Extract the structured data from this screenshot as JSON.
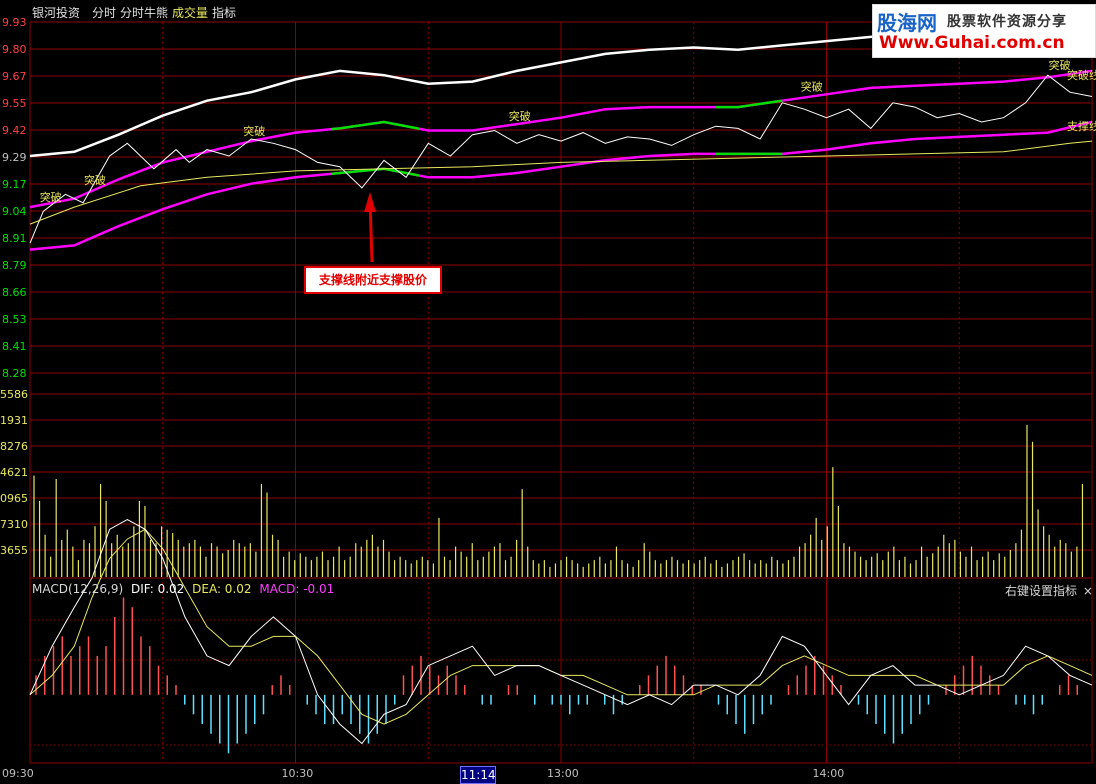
{
  "menu": {
    "app": "银河投资",
    "item1": "分时",
    "item2": "分时牛熊",
    "item3": "成交量",
    "item4": "指标"
  },
  "logo": {
    "line1": "股海网",
    "line2": "股票软件资源分享",
    "line3": "Www.Guhai.com.cn"
  },
  "callout": {
    "text": "支撑线附近支撑股价"
  },
  "macd_label": {
    "name": "MACD(12,26,9)",
    "dif": "DIF: 0.02",
    "dea": "DEA: 0.02",
    "macd": "MACD: -0.01"
  },
  "right_setting": "右键设置指标",
  "right_close": "×",
  "time_current": "11:14",
  "colors": {
    "grid": "#8b0000",
    "price": "#ffffff",
    "avg": "#e8e860",
    "magenta": "#ff00ff",
    "green": "#00e000",
    "volume": "#e8e860",
    "macd_pos": "#ff5050",
    "macd_neg": "#60e0ff",
    "label_up": "#ff4040",
    "label_down": "#00e000"
  },
  "chart_data": {
    "type": "line",
    "price_axis_ticks": [
      "9.93",
      "9.80",
      "9.67",
      "9.55",
      "9.42",
      "9.29",
      "9.17",
      "9.04",
      "8.91",
      "8.79",
      "8.66",
      "8.53",
      "8.41",
      "8.28"
    ],
    "volume_axis_ticks": [
      "5586",
      "1931",
      "8276",
      "4621",
      "0965",
      "7310",
      "3655"
    ],
    "x_ticks": [
      "09:30",
      "10:30",
      "13:00",
      "14:00"
    ],
    "ylim": [
      8.28,
      9.93
    ],
    "price": {
      "t": [
        0,
        3,
        8,
        12,
        18,
        22,
        28,
        33,
        36,
        40,
        45,
        50,
        55,
        60,
        65,
        70,
        75,
        80,
        85,
        90,
        95,
        100,
        105,
        110,
        115,
        120,
        125,
        130,
        135,
        140,
        145,
        150,
        155,
        160,
        165,
        170,
        175,
        180,
        185,
        190,
        195,
        200,
        205,
        210,
        215,
        220,
        225,
        230,
        235,
        240
      ],
      "v": [
        8.89,
        9.04,
        9.12,
        9.08,
        9.3,
        9.36,
        9.24,
        9.33,
        9.27,
        9.33,
        9.3,
        9.38,
        9.36,
        9.33,
        9.27,
        9.25,
        9.15,
        9.28,
        9.2,
        9.36,
        9.3,
        9.4,
        9.42,
        9.36,
        9.4,
        9.37,
        9.41,
        9.36,
        9.39,
        9.38,
        9.35,
        9.4,
        9.44,
        9.43,
        9.38,
        9.55,
        9.52,
        9.48,
        9.52,
        9.43,
        9.55,
        9.53,
        9.48,
        9.5,
        9.46,
        9.48,
        9.55,
        9.68,
        9.6,
        9.58
      ]
    },
    "avg": {
      "t": [
        0,
        10,
        25,
        40,
        60,
        80,
        100,
        120,
        140,
        160,
        180,
        200,
        220,
        235,
        240
      ],
      "v": [
        8.98,
        9.06,
        9.16,
        9.2,
        9.23,
        9.24,
        9.25,
        9.27,
        9.28,
        9.29,
        9.3,
        9.31,
        9.32,
        9.36,
        9.37
      ]
    },
    "upper": {
      "t": [
        0,
        10,
        20,
        30,
        40,
        50,
        60,
        70,
        80,
        90,
        100,
        110,
        120,
        130,
        140,
        150,
        160,
        170,
        180,
        190,
        200,
        210,
        220,
        230,
        240
      ],
      "v": [
        9.3,
        9.32,
        9.4,
        9.49,
        9.56,
        9.6,
        9.66,
        9.7,
        9.68,
        9.64,
        9.65,
        9.7,
        9.74,
        9.78,
        9.8,
        9.81,
        9.8,
        9.82,
        9.84,
        9.86,
        9.88,
        9.89,
        9.89,
        9.9,
        9.91
      ]
    },
    "resistance": {
      "t": [
        0,
        10,
        20,
        30,
        40,
        50,
        60,
        70,
        80,
        85,
        90,
        100,
        110,
        120,
        130,
        140,
        150,
        160,
        170,
        180,
        190,
        200,
        210,
        220,
        230,
        240
      ],
      "v": [
        9.06,
        9.1,
        9.19,
        9.27,
        9.32,
        9.37,
        9.41,
        9.43,
        9.46,
        9.44,
        9.42,
        9.42,
        9.45,
        9.48,
        9.52,
        9.53,
        9.53,
        9.53,
        9.56,
        9.59,
        9.62,
        9.63,
        9.64,
        9.65,
        9.67,
        9.7
      ],
      "green_ranges": [
        [
          68,
          88
        ],
        [
          155,
          170
        ]
      ]
    },
    "support": {
      "t": [
        0,
        10,
        20,
        30,
        40,
        50,
        60,
        70,
        80,
        85,
        90,
        100,
        110,
        120,
        130,
        140,
        150,
        160,
        170,
        180,
        190,
        200,
        210,
        220,
        230,
        240
      ],
      "v": [
        8.86,
        8.88,
        8.97,
        9.05,
        9.12,
        9.17,
        9.2,
        9.22,
        9.24,
        9.22,
        9.2,
        9.2,
        9.22,
        9.25,
        9.28,
        9.3,
        9.31,
        9.31,
        9.31,
        9.33,
        9.36,
        9.38,
        9.39,
        9.4,
        9.41,
        9.46
      ],
      "green_ranges": [
        [
          68,
          88
        ],
        [
          155,
          170
        ]
      ]
    },
    "breakout_label": "突破",
    "breakouts": [
      {
        "t": 4,
        "v": 9.06
      },
      {
        "t": 14,
        "v": 9.14
      },
      {
        "t": 50,
        "v": 9.37
      },
      {
        "t": 110,
        "v": 9.44
      },
      {
        "t": 176,
        "v": 9.58
      },
      {
        "t": 232,
        "v": 9.68
      }
    ],
    "right_labels": [
      {
        "text": "突破线",
        "v": 9.68
      },
      {
        "text": "支撑线",
        "v": 9.44
      }
    ],
    "volume": [
      0.6,
      0.45,
      0.25,
      0.12,
      0.58,
      0.22,
      0.28,
      0.18,
      0.1,
      0.22,
      0.2,
      0.3,
      0.55,
      0.45,
      0.2,
      0.25,
      0.18,
      0.2,
      0.3,
      0.45,
      0.42,
      0.22,
      0.2,
      0.3,
      0.28,
      0.26,
      0.22,
      0.18,
      0.2,
      0.22,
      0.18,
      0.12,
      0.2,
      0.18,
      0.14,
      0.16,
      0.22,
      0.2,
      0.18,
      0.2,
      0.15,
      0.55,
      0.5,
      0.25,
      0.22,
      0.12,
      0.15,
      0.1,
      0.14,
      0.12,
      0.1,
      0.12,
      0.15,
      0.1,
      0.12,
      0.18,
      0.1,
      0.12,
      0.2,
      0.18,
      0.22,
      0.25,
      0.18,
      0.22,
      0.15,
      0.1,
      0.12,
      0.1,
      0.08,
      0.1,
      0.12,
      0.1,
      0.08,
      0.35,
      0.12,
      0.1,
      0.18,
      0.15,
      0.12,
      0.2,
      0.1,
      0.12,
      0.15,
      0.18,
      0.2,
      0.1,
      0.12,
      0.22,
      0.52,
      0.18,
      0.1,
      0.08,
      0.1,
      0.06,
      0.08,
      0.1,
      0.12,
      0.1,
      0.08,
      0.06,
      0.08,
      0.1,
      0.12,
      0.08,
      0.1,
      0.18,
      0.1,
      0.08,
      0.06,
      0.1,
      0.2,
      0.15,
      0.1,
      0.08,
      0.1,
      0.12,
      0.1,
      0.08,
      0.1,
      0.08,
      0.1,
      0.12,
      0.08,
      0.1,
      0.06,
      0.08,
      0.1,
      0.12,
      0.14,
      0.1,
      0.08,
      0.1,
      0.08,
      0.12,
      0.1,
      0.08,
      0.1,
      0.12,
      0.18,
      0.2,
      0.25,
      0.35,
      0.22,
      0.3,
      0.65,
      0.42,
      0.2,
      0.18,
      0.15,
      0.12,
      0.1,
      0.12,
      0.14,
      0.1,
      0.15,
      0.18,
      0.1,
      0.12,
      0.08,
      0.1,
      0.18,
      0.12,
      0.14,
      0.18,
      0.25,
      0.2,
      0.22,
      0.15,
      0.12,
      0.18,
      0.1,
      0.12,
      0.15,
      0.1,
      0.14,
      0.12,
      0.16,
      0.2,
      0.28,
      0.9,
      0.8,
      0.4,
      0.3,
      0.25,
      0.18,
      0.22,
      0.2,
      0.15,
      0.18,
      0.55
    ],
    "macd_dif": {
      "t": [
        0,
        5,
        10,
        14,
        18,
        22,
        26,
        30,
        35,
        40,
        45,
        50,
        55,
        60,
        65,
        70,
        75,
        80,
        85,
        90,
        95,
        100,
        105,
        110,
        115,
        120,
        125,
        130,
        135,
        140,
        145,
        150,
        155,
        160,
        165,
        170,
        175,
        180,
        185,
        190,
        195,
        200,
        205,
        210,
        215,
        220,
        225,
        230,
        235,
        240
      ],
      "v": [
        0.0,
        0.05,
        0.09,
        0.12,
        0.17,
        0.18,
        0.17,
        0.14,
        0.08,
        0.04,
        0.03,
        0.06,
        0.08,
        0.06,
        0.0,
        -0.03,
        -0.05,
        -0.02,
        -0.01,
        0.03,
        0.04,
        0.05,
        0.02,
        0.03,
        0.03,
        0.02,
        0.01,
        0.0,
        -0.01,
        0.0,
        -0.01,
        0.01,
        0.01,
        0.0,
        0.02,
        0.06,
        0.05,
        0.02,
        -0.01,
        0.02,
        0.03,
        0.01,
        0.01,
        0.0,
        0.01,
        0.02,
        0.05,
        0.04,
        0.02,
        0.01
      ]
    },
    "macd_dea": {
      "t": [
        0,
        5,
        10,
        14,
        18,
        22,
        26,
        30,
        35,
        40,
        45,
        50,
        55,
        60,
        65,
        70,
        75,
        80,
        85,
        90,
        95,
        100,
        105,
        110,
        115,
        120,
        125,
        130,
        135,
        140,
        145,
        150,
        155,
        160,
        165,
        170,
        175,
        180,
        185,
        190,
        195,
        200,
        205,
        210,
        215,
        220,
        225,
        230,
        235,
        240
      ],
      "v": [
        0.0,
        0.02,
        0.05,
        0.1,
        0.14,
        0.16,
        0.17,
        0.15,
        0.11,
        0.07,
        0.05,
        0.05,
        0.06,
        0.06,
        0.04,
        0.01,
        -0.02,
        -0.03,
        -0.02,
        0.0,
        0.02,
        0.03,
        0.03,
        0.03,
        0.03,
        0.02,
        0.02,
        0.01,
        0.0,
        0.0,
        0.0,
        0.0,
        0.01,
        0.01,
        0.01,
        0.03,
        0.04,
        0.03,
        0.02,
        0.02,
        0.02,
        0.02,
        0.01,
        0.01,
        0.01,
        0.01,
        0.03,
        0.04,
        0.03,
        0.02
      ]
    },
    "macd_hist": [
      0.02,
      0.04,
      0.05,
      0.06,
      0.04,
      0.05,
      0.06,
      0.04,
      0.05,
      0.08,
      0.1,
      0.09,
      0.06,
      0.05,
      0.03,
      0.02,
      0.01,
      -0.01,
      -0.02,
      -0.03,
      -0.04,
      -0.05,
      -0.06,
      -0.05,
      -0.04,
      -0.03,
      -0.02,
      0.01,
      0.02,
      0.01,
      0.0,
      -0.01,
      -0.02,
      -0.03,
      -0.03,
      -0.02,
      -0.03,
      -0.04,
      -0.05,
      -0.04,
      -0.03,
      -0.01,
      0.02,
      0.03,
      0.04,
      0.03,
      0.02,
      0.03,
      0.02,
      0.01,
      0.0,
      -0.01,
      -0.01,
      0.0,
      0.01,
      0.01,
      0.0,
      -0.01,
      0.0,
      -0.01,
      -0.01,
      -0.02,
      -0.01,
      -0.01,
      0.0,
      -0.01,
      -0.02,
      -0.01,
      0.0,
      0.01,
      0.02,
      0.03,
      0.04,
      0.03,
      0.02,
      0.01,
      0.01,
      0.0,
      -0.01,
      -0.02,
      -0.03,
      -0.04,
      -0.03,
      -0.02,
      -0.01,
      0.0,
      0.01,
      0.02,
      0.03,
      0.04,
      0.03,
      0.02,
      0.01,
      0.0,
      -0.01,
      -0.02,
      -0.03,
      -0.04,
      -0.05,
      -0.04,
      -0.03,
      -0.02,
      -0.01,
      0.0,
      0.01,
      0.02,
      0.03,
      0.04,
      0.03,
      0.02,
      0.01,
      0.0,
      -0.01,
      -0.01,
      -0.02,
      -0.01,
      0.0,
      0.01,
      0.02,
      0.01
    ],
    "macd_ylim": [
      -0.07,
      0.12
    ]
  }
}
